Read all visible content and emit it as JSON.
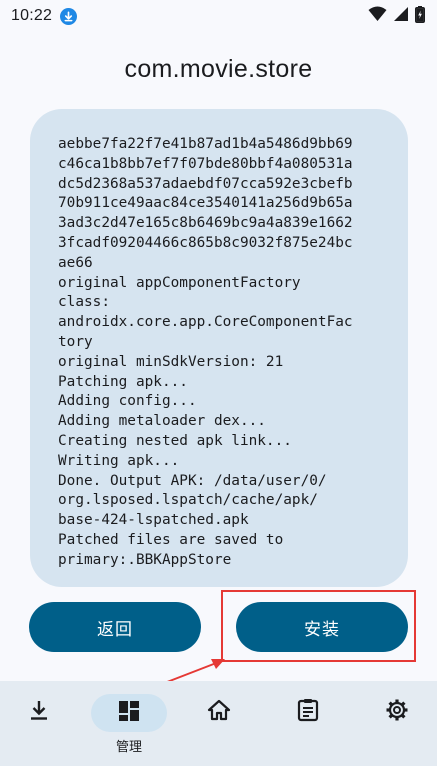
{
  "status_bar": {
    "time": "10:22",
    "icons": [
      "download-badge-icon",
      "wifi-icon",
      "cell-signal-icon",
      "battery-charging-icon"
    ]
  },
  "page": {
    "title": "com.movie.store"
  },
  "log": {
    "lines": [
      "aebbe7fa22f7e41b87ad1b4a5486d9bb69",
      "c46ca1b8bb7ef7f07bde80bbf4a080531a",
      "dc5d2368a537adaebdf07cca592e3cbefb",
      "70b911ce49aac84ce3540141a256d9b65a",
      "3ad3c2d47e165c8b6469bc9a4a839e1662",
      "3fcadf09204466c865b8c9032f875e24bc",
      "ae66",
      "original appComponentFactory",
      "class:",
      "androidx.core.app.CoreComponentFac",
      "tory",
      "original minSdkVersion: 21",
      "Patching apk...",
      "Adding config...",
      "Adding metaloader dex...",
      "Creating nested apk link...",
      "Writing apk...",
      "Done. Output APK: /data/user/0/",
      "org.lsposed.lspatch/cache/apk/",
      "base-424-lspatched.apk",
      "Patched files are saved to",
      "primary:.BBKAppStore"
    ]
  },
  "actions": {
    "back_label": "返回",
    "install_label": "安装"
  },
  "bottom_nav": {
    "items": [
      {
        "icon": "download-icon",
        "label": ""
      },
      {
        "icon": "dashboard-icon",
        "label": "管理",
        "active": true
      },
      {
        "icon": "home-icon",
        "label": ""
      },
      {
        "icon": "clipboard-list-icon",
        "label": ""
      },
      {
        "icon": "settings-gear-icon",
        "label": ""
      }
    ]
  },
  "colors": {
    "primary": "#005f89",
    "card_bg": "#d6e4f0",
    "nav_bg": "#e4ebf2",
    "annotation": "#e53935"
  }
}
